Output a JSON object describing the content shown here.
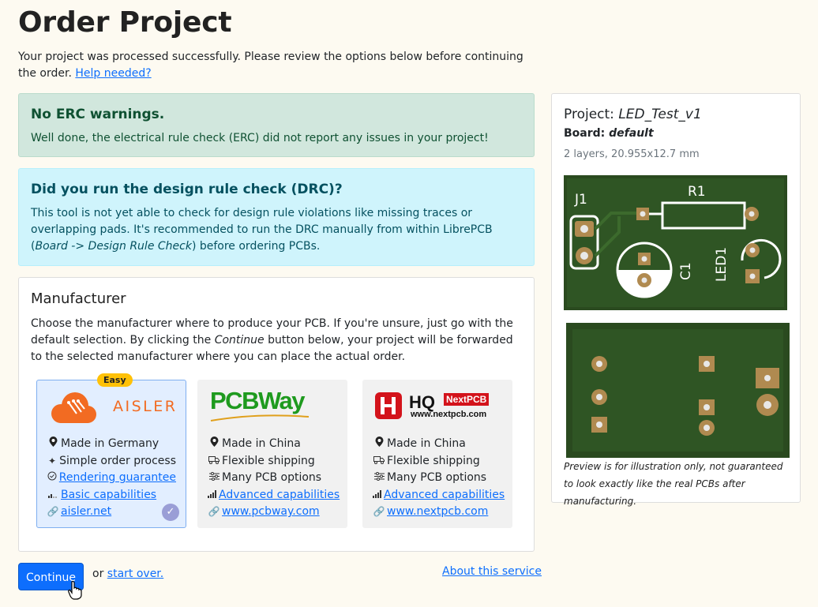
{
  "page": {
    "title": "Order Project",
    "intro_text": "Your project was processed successfully. Please review the options below before continuing the order.",
    "help_link": "Help needed?"
  },
  "erc": {
    "title": "No ERC warnings.",
    "text": "Well done, the electrical rule check (ERC) did not report any issues in your project!"
  },
  "drc": {
    "title": "Did you run the design rule check (DRC)?",
    "text_before": "This tool is not yet able to check for design rule violations like missing traces or overlapping pads. It's recommended to run the DRC manually from within LibrePCB (",
    "menu_path": "Board -> Design Rule Check",
    "text_after": ") before ordering PCBs."
  },
  "manufacturer": {
    "title": "Manufacturer",
    "text_before": "Choose the manufacturer where to produce your PCB. If you're unsure, just go with the default selection. By clicking the ",
    "continue_word": "Continue",
    "text_after": " button below, your project will be forwarded to the selected manufacturer where you can place the actual order.",
    "options": [
      {
        "logo_text": "AISLER",
        "badge": "Easy",
        "selected": true,
        "features": [
          {
            "icon": "map-pin-icon",
            "text": "Made in Germany"
          },
          {
            "icon": "magic-wand-icon",
            "text": "Simple order process"
          },
          {
            "icon": "check-circle-icon",
            "text": "Rendering guarantee",
            "link": true
          },
          {
            "icon": "signal-low-icon",
            "text": "Basic capabilities",
            "link": true
          },
          {
            "icon": "link-icon",
            "text": "aisler.net",
            "link": true
          }
        ]
      },
      {
        "logo_text": "PCBWay",
        "selected": false,
        "features": [
          {
            "icon": "map-pin-icon",
            "text": "Made in China"
          },
          {
            "icon": "truck-icon",
            "text": "Flexible shipping"
          },
          {
            "icon": "sliders-icon",
            "text": "Many PCB options"
          },
          {
            "icon": "signal-full-icon",
            "text": "Advanced capabilities",
            "link": true
          },
          {
            "icon": "link-icon",
            "text": "www.pcbway.com",
            "link": true
          }
        ]
      },
      {
        "logo_text": "HQ",
        "logo_badge": "NextPCB",
        "logo_sub": "www.nextpcb.com",
        "selected": false,
        "features": [
          {
            "icon": "map-pin-icon",
            "text": "Made in China"
          },
          {
            "icon": "truck-icon",
            "text": "Flexible shipping"
          },
          {
            "icon": "sliders-icon",
            "text": "Many PCB options"
          },
          {
            "icon": "signal-full-icon",
            "text": "Advanced capabilities",
            "link": true
          },
          {
            "icon": "link-icon",
            "text": "www.nextpcb.com",
            "link": true
          }
        ]
      }
    ]
  },
  "actions": {
    "continue_label": "Continue",
    "or_text": "or",
    "start_over": "start over.",
    "about": "About this service"
  },
  "project": {
    "label": "Project:",
    "name": "LED_Test_v1",
    "board_label": "Board:",
    "board_name": "default",
    "layers": "2 layers, 20.955x12.7 mm",
    "silk": {
      "j1": "J1",
      "r1": "R1",
      "c1": "C1",
      "led1": "LED1"
    },
    "preview_note": "Preview is for illustration only, not guaranteed to look exactly like the real PCBs after manufacturing."
  },
  "colors": {
    "pcb_green": "#2f5524",
    "pad_gold": "#b08a50",
    "primary": "#0d6efd"
  }
}
